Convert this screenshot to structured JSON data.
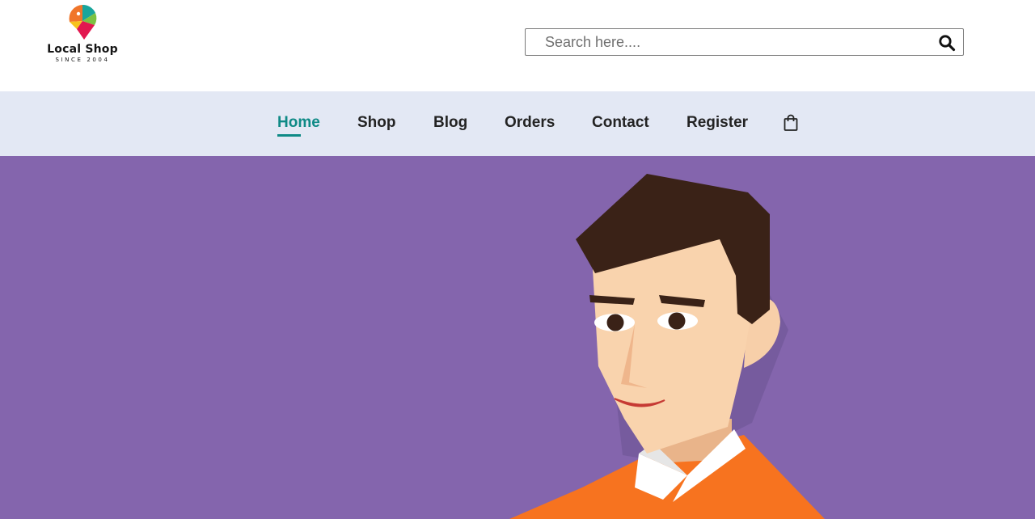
{
  "brand": {
    "name": "Local Shop",
    "tagline": "SINCE 2004",
    "colors": {
      "orange": "#f0752a",
      "teal": "#19a59c",
      "green": "#7cc242",
      "yellow": "#f7c31c",
      "pink": "#e2174f"
    }
  },
  "search": {
    "placeholder": "Search here....",
    "value": "",
    "icon": "search-icon"
  },
  "nav": {
    "items": [
      {
        "label": "Home",
        "active": true
      },
      {
        "label": "Shop",
        "active": false
      },
      {
        "label": "Blog",
        "active": false
      },
      {
        "label": "Orders",
        "active": false
      },
      {
        "label": "Contact",
        "active": false
      },
      {
        "label": "Register",
        "active": false
      }
    ],
    "cart_icon": "shopping-bag-icon"
  },
  "colors": {
    "accent": "#0f8a86",
    "nav_background": "#e3e8f4",
    "hero_background": "#8465ad"
  },
  "hero": {
    "illustration": "cartoon-man-orange-sweater"
  }
}
